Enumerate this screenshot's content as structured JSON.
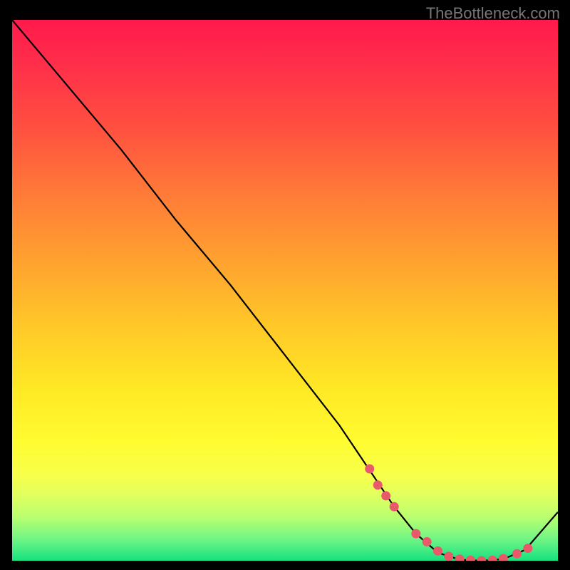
{
  "attribution": "TheBottleneck.com",
  "chart_data": {
    "type": "line",
    "title": "",
    "xlabel": "",
    "ylabel": "",
    "xlim": [
      0,
      100
    ],
    "ylim": [
      0,
      100
    ],
    "series": [
      {
        "name": "curve",
        "x": [
          0,
          5,
          10,
          20,
          30,
          40,
          50,
          60,
          66,
          70,
          74,
          78,
          82,
          86,
          90,
          94,
          100
        ],
        "y": [
          100,
          94,
          88,
          76,
          63,
          51,
          38,
          25,
          16,
          10,
          5,
          1.5,
          0.2,
          0,
          0.3,
          2,
          9
        ]
      }
    ],
    "markers": {
      "name": "highlight-points",
      "x": [
        65.5,
        67,
        68.5,
        70,
        74,
        76,
        78,
        80,
        82,
        84,
        86,
        88,
        90,
        92.5,
        94.5
      ],
      "y": [
        17,
        14,
        12,
        10,
        5,
        3.5,
        1.8,
        0.8,
        0.3,
        0.1,
        0,
        0.1,
        0.4,
        1.3,
        2.3
      ]
    },
    "colors": {
      "curve": "#000000",
      "markers": "#e85a6a"
    }
  }
}
